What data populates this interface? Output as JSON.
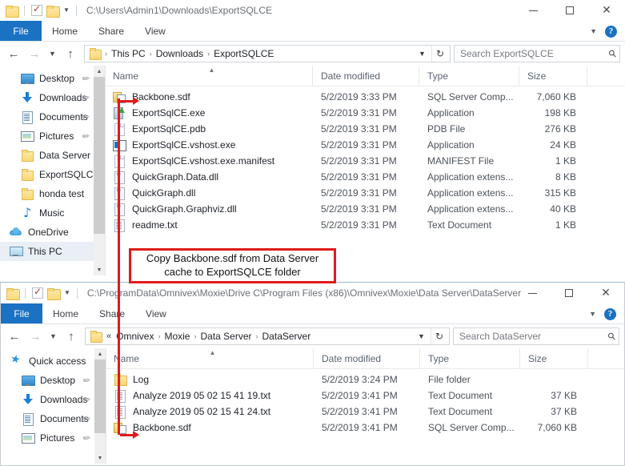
{
  "window_top": {
    "title_path": "C:\\Users\\Admin1\\Downloads\\ExportSQLCE",
    "qat": {
      "folder_label": "folder-icon",
      "properties_label": "properties-icon",
      "newfolder_label": "new-folder-icon",
      "dropdown_label": "▾"
    },
    "controls": {
      "minimize": "—",
      "maximize": "□",
      "close": "✕",
      "help": "?"
    },
    "ribbon_tabs": [
      "File",
      "Home",
      "Share",
      "View"
    ],
    "nav": {
      "back": "←",
      "forward": "→",
      "recent": "⌄",
      "up": "↑",
      "crumbs": [
        "This PC",
        "Downloads",
        "ExportSQLCE"
      ],
      "crumb_sep": "›",
      "dropdown": "⌄",
      "refresh": "↻"
    },
    "search": {
      "placeholder": "Search ExportSQLCE",
      "icon": "⌕"
    },
    "navpane": [
      {
        "label": "Desktop",
        "icon": "desktop-icon",
        "pinned": true,
        "indent": true
      },
      {
        "label": "Downloads",
        "icon": "downloads-icon",
        "pinned": true,
        "indent": true
      },
      {
        "label": "Documents",
        "icon": "documents-icon",
        "pinned": true,
        "indent": true
      },
      {
        "label": "Pictures",
        "icon": "pictures-icon",
        "pinned": true,
        "indent": true
      },
      {
        "label": "Data Server",
        "icon": "folder-icon",
        "pinned": false,
        "indent": true
      },
      {
        "label": "ExportSQLCE",
        "icon": "folder-icon",
        "pinned": false,
        "indent": true
      },
      {
        "label": "honda test",
        "icon": "folder-icon",
        "pinned": false,
        "indent": true
      },
      {
        "label": "Music",
        "icon": "music-icon",
        "pinned": false,
        "indent": true
      },
      {
        "label": "OneDrive",
        "icon": "onedrive-icon",
        "pinned": false,
        "indent": false
      },
      {
        "label": "This PC",
        "icon": "this-pc-icon",
        "pinned": false,
        "indent": false,
        "selected": true
      }
    ],
    "columns": [
      "Name",
      "Date modified",
      "Type",
      "Size"
    ],
    "rows": [
      {
        "name": "Backbone.sdf",
        "date": "5/2/2019 3:33 PM",
        "type": "SQL Server Comp...",
        "size": "7,060 KB",
        "icon": "sdf-file-icon"
      },
      {
        "name": "ExportSqlCE.exe",
        "date": "5/2/2019 3:31 PM",
        "type": "Application",
        "size": "198 KB",
        "icon": "exe-file-icon"
      },
      {
        "name": "ExportSqlCE.pdb",
        "date": "5/2/2019 3:31 PM",
        "type": "PDB File",
        "size": "276 KB",
        "icon": "blank-file-icon"
      },
      {
        "name": "ExportSqlCE.vshost.exe",
        "date": "5/2/2019 3:31 PM",
        "type": "Application",
        "size": "24 KB",
        "icon": "vshost-file-icon"
      },
      {
        "name": "ExportSqlCE.vshost.exe.manifest",
        "date": "5/2/2019 3:31 PM",
        "type": "MANIFEST File",
        "size": "1 KB",
        "icon": "blank-file-icon"
      },
      {
        "name": "QuickGraph.Data.dll",
        "date": "5/2/2019 3:31 PM",
        "type": "Application extens...",
        "size": "8 KB",
        "icon": "dll-file-icon"
      },
      {
        "name": "QuickGraph.dll",
        "date": "5/2/2019 3:31 PM",
        "type": "Application extens...",
        "size": "315 KB",
        "icon": "dll-file-icon"
      },
      {
        "name": "QuickGraph.Graphviz.dll",
        "date": "5/2/2019 3:31 PM",
        "type": "Application extens...",
        "size": "40 KB",
        "icon": "dll-file-icon"
      },
      {
        "name": "readme.txt",
        "date": "5/2/2019 3:31 PM",
        "type": "Text Document",
        "size": "1 KB",
        "icon": "txt-file-icon"
      }
    ]
  },
  "window_bottom": {
    "title_path": "C:\\ProgramData\\Omnivex\\Moxie\\Drive C\\Program Files (x86)\\Omnivex\\Moxie\\Data Server\\DataServer",
    "controls": {
      "minimize": "—",
      "maximize": "□",
      "close": "✕",
      "help": "?"
    },
    "ribbon_tabs": [
      "File",
      "Home",
      "Share",
      "View"
    ],
    "nav": {
      "back": "←",
      "forward": "→",
      "recent": "⌄",
      "up": "↑",
      "overflow": "«",
      "crumbs": [
        "Omnivex",
        "Moxie",
        "Data Server",
        "DataServer"
      ],
      "crumb_sep": "›",
      "dropdown": "⌄",
      "refresh": "↻"
    },
    "search": {
      "placeholder": "Search DataServer",
      "icon": "⌕"
    },
    "navpane": [
      {
        "label": "Quick access",
        "icon": "quick-access-icon",
        "pinned": false,
        "indent": false
      },
      {
        "label": "Desktop",
        "icon": "desktop-icon",
        "pinned": true,
        "indent": true
      },
      {
        "label": "Downloads",
        "icon": "downloads-icon",
        "pinned": true,
        "indent": true
      },
      {
        "label": "Documents",
        "icon": "documents-icon",
        "pinned": true,
        "indent": true
      },
      {
        "label": "Pictures",
        "icon": "pictures-icon",
        "pinned": true,
        "indent": true
      }
    ],
    "columns": [
      "Name",
      "Date modified",
      "Type",
      "Size"
    ],
    "rows": [
      {
        "name": "Log",
        "date": "5/2/2019 3:24 PM",
        "type": "File folder",
        "size": "",
        "icon": "folder-icon"
      },
      {
        "name": "Analyze 2019 05 02 15 41 19.txt",
        "date": "5/2/2019 3:41 PM",
        "type": "Text Document",
        "size": "37 KB",
        "icon": "txt-file-icon"
      },
      {
        "name": "Analyze 2019 05 02 15 41 24.txt",
        "date": "5/2/2019 3:41 PM",
        "type": "Text Document",
        "size": "37 KB",
        "icon": "txt-file-icon"
      },
      {
        "name": "Backbone.sdf",
        "date": "5/2/2019 3:41 PM",
        "type": "SQL Server Comp...",
        "size": "7,060 KB",
        "icon": "sdf-file-icon"
      }
    ]
  },
  "annotation": {
    "line1": "Copy Backbone.sdf from Data Server",
    "line2": "cache to ExportSQLCE folder",
    "color": "#e01b1b"
  }
}
